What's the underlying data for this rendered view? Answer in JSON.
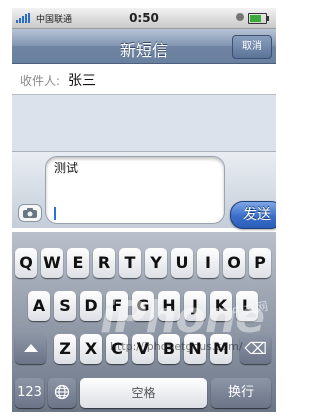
{
  "status": {
    "carrier": "中国联通",
    "time": "0:50"
  },
  "nav": {
    "title": "新短信",
    "cancel": "取消"
  },
  "recipient": {
    "label": "收件人:",
    "name": "张三"
  },
  "compose": {
    "text": "测试",
    "send": "发送"
  },
  "keyboard": {
    "row1": [
      "Q",
      "W",
      "E",
      "R",
      "T",
      "Y",
      "U",
      "I",
      "O",
      "P"
    ],
    "row2": [
      "A",
      "S",
      "D",
      "F",
      "G",
      "H",
      "J",
      "K",
      "L"
    ],
    "row3": [
      "Z",
      "X",
      "C",
      "V",
      "B",
      "N",
      "M"
    ],
    "numbers": "123",
    "space": "空格",
    "return": "换行"
  },
  "watermark": {
    "brand": "iPhone",
    "cn": "中文网",
    "url": "http://iphonetgous.com/"
  },
  "icons": [
    "signal-icon",
    "battery-icon",
    "camera-icon",
    "shift-icon",
    "backspace-icon",
    "globe-icon"
  ],
  "colors": {
    "nav": "#7d91ae",
    "send": "#3a6fc9",
    "keyboard": "#8b95a6"
  }
}
